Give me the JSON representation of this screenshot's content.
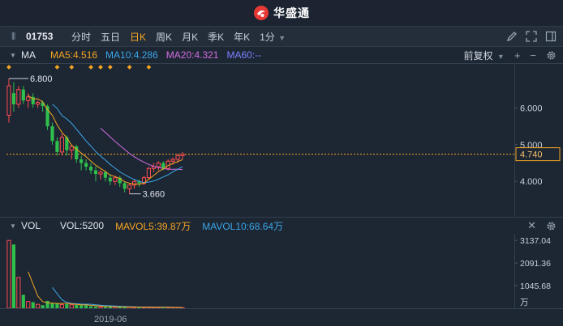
{
  "app": {
    "name": "华盛通"
  },
  "toolbar": {
    "handle_glyph": "⦀",
    "stock_code": "01753",
    "periods": [
      {
        "label": "分时",
        "active": false
      },
      {
        "label": "五日",
        "active": false
      },
      {
        "label": "日K",
        "active": true
      },
      {
        "label": "周K",
        "active": false
      },
      {
        "label": "月K",
        "active": false
      },
      {
        "label": "季K",
        "active": false
      },
      {
        "label": "年K",
        "active": false
      },
      {
        "label": "1分",
        "active": false,
        "dropdown": true
      }
    ],
    "icons": [
      "pencil-icon",
      "fullscreen-icon",
      "sidebar-toggle-icon"
    ]
  },
  "price_panel": {
    "label": "MA",
    "ma": [
      {
        "label": "MA5:4.516",
        "color": "#f5a623"
      },
      {
        "label": "MA10:4.286",
        "color": "#3aa7e8"
      },
      {
        "label": "MA20:4.321",
        "color": "#d36ee0"
      },
      {
        "label": "MA60:--",
        "color": "#7b82ff"
      }
    ],
    "adjust_label": "前复权",
    "high_label": "6.800",
    "low_label": "3.660",
    "current_price": "4.740",
    "axis_ticks": [
      "6.000",
      "5.000",
      "4.000"
    ],
    "axis_values": [
      6.0,
      5.0,
      4.0
    ],
    "current_value": 4.74
  },
  "volume_panel": {
    "label": "VOL",
    "vol_label": "VOL:5200",
    "mavol": [
      {
        "label": "MAVOL5:39.87万",
        "color": "#f5a623"
      },
      {
        "label": "MAVOL10:68.64万",
        "color": "#3aa7e8"
      }
    ],
    "axis_ticks": [
      "3137.04",
      "2091.36",
      "1045.68"
    ],
    "axis_unit": "万"
  },
  "date_axis": {
    "labels": [
      "2019-06"
    ]
  },
  "colors": {
    "up": "#ff4d4f",
    "down": "#2fbf4d",
    "ma5": "#f5a623",
    "ma10": "#3aa7e8",
    "ma20": "#d36ee0",
    "marker": "#f5a623"
  },
  "chart_data": {
    "type": "candlestick",
    "ylim": [
      3.3,
      7.0
    ],
    "candles": [
      {
        "o": 5.8,
        "c": 6.6,
        "h": 6.8,
        "l": 5.6
      },
      {
        "o": 6.4,
        "c": 6.1,
        "h": 6.7,
        "l": 5.9
      },
      {
        "o": 6.1,
        "c": 6.5,
        "h": 6.6,
        "l": 6.0
      },
      {
        "o": 6.5,
        "c": 6.2,
        "h": 6.6,
        "l": 6.1
      },
      {
        "o": 6.2,
        "c": 6.3,
        "h": 6.4,
        "l": 6.0
      },
      {
        "o": 6.3,
        "c": 6.1,
        "h": 6.4,
        "l": 6.0
      },
      {
        "o": 6.1,
        "c": 6.15,
        "h": 6.2,
        "l": 6.0
      },
      {
        "o": 6.15,
        "c": 6.05,
        "h": 6.2,
        "l": 5.9
      },
      {
        "o": 6.05,
        "c": 5.5,
        "h": 6.1,
        "l": 5.4
      },
      {
        "o": 5.5,
        "c": 5.1,
        "h": 5.6,
        "l": 5.0
      },
      {
        "o": 5.1,
        "c": 4.8,
        "h": 5.2,
        "l": 4.7
      },
      {
        "o": 4.8,
        "c": 5.2,
        "h": 5.3,
        "l": 4.7
      },
      {
        "o": 5.2,
        "c": 4.85,
        "h": 5.25,
        "l": 4.7
      },
      {
        "o": 4.85,
        "c": 4.95,
        "h": 5.0,
        "l": 4.6
      },
      {
        "o": 4.95,
        "c": 4.6,
        "h": 5.0,
        "l": 4.5
      },
      {
        "o": 4.6,
        "c": 4.5,
        "h": 4.7,
        "l": 4.3
      },
      {
        "o": 4.5,
        "c": 4.4,
        "h": 4.6,
        "l": 4.3
      },
      {
        "o": 4.4,
        "c": 4.3,
        "h": 4.5,
        "l": 4.2
      },
      {
        "o": 4.3,
        "c": 4.2,
        "h": 4.4,
        "l": 4.0
      },
      {
        "o": 4.2,
        "c": 4.25,
        "h": 4.3,
        "l": 4.05
      },
      {
        "o": 4.25,
        "c": 4.1,
        "h": 4.3,
        "l": 4.0
      },
      {
        "o": 4.1,
        "c": 4.0,
        "h": 4.2,
        "l": 3.9
      },
      {
        "o": 4.0,
        "c": 4.1,
        "h": 4.15,
        "l": 3.9
      },
      {
        "o": 4.1,
        "c": 3.95,
        "h": 4.15,
        "l": 3.85
      },
      {
        "o": 3.95,
        "c": 3.8,
        "h": 4.0,
        "l": 3.7
      },
      {
        "o": 3.8,
        "c": 3.9,
        "h": 3.95,
        "l": 3.66
      },
      {
        "o": 3.9,
        "c": 4.0,
        "h": 4.05,
        "l": 3.8
      },
      {
        "o": 4.0,
        "c": 3.95,
        "h": 4.05,
        "l": 3.85
      },
      {
        "o": 3.95,
        "c": 4.1,
        "h": 4.15,
        "l": 3.9
      },
      {
        "o": 4.1,
        "c": 4.35,
        "h": 4.4,
        "l": 4.05
      },
      {
        "o": 4.35,
        "c": 4.4,
        "h": 4.5,
        "l": 4.25
      },
      {
        "o": 4.4,
        "c": 4.5,
        "h": 4.55,
        "l": 4.3
      },
      {
        "o": 4.5,
        "c": 4.35,
        "h": 4.55,
        "l": 4.3
      },
      {
        "o": 4.35,
        "c": 4.55,
        "h": 4.6,
        "l": 4.3
      },
      {
        "o": 4.55,
        "c": 4.6,
        "h": 4.65,
        "l": 4.45
      },
      {
        "o": 4.6,
        "c": 4.7,
        "h": 4.75,
        "l": 4.5
      },
      {
        "o": 4.7,
        "c": 4.74,
        "h": 4.8,
        "l": 4.6
      }
    ],
    "volumes": [
      3137,
      2950,
      1420,
      620,
      310,
      280,
      180,
      140,
      340,
      240,
      210,
      170,
      190,
      160,
      150,
      140,
      130,
      90,
      80,
      70,
      60,
      65,
      55,
      50,
      60,
      55,
      45,
      40,
      35,
      50,
      45,
      40,
      30,
      35,
      30,
      25,
      25
    ],
    "ma5": [
      null,
      null,
      null,
      null,
      6.34,
      6.24,
      6.25,
      6.16,
      5.96,
      5.8,
      5.54,
      5.33,
      5.19,
      4.98,
      4.88,
      4.77,
      4.67,
      4.55,
      4.44,
      4.35,
      4.27,
      4.17,
      4.13,
      4.08,
      3.99,
      3.95,
      3.93,
      3.92,
      3.95,
      4.06,
      4.16,
      4.27,
      4.34,
      4.43,
      4.49,
      4.54,
      4.59
    ],
    "ma10": [
      null,
      null,
      null,
      null,
      null,
      null,
      null,
      null,
      null,
      6.1,
      5.99,
      5.79,
      5.7,
      5.58,
      5.42,
      5.26,
      5.1,
      4.96,
      4.81,
      4.69,
      4.58,
      4.46,
      4.36,
      4.26,
      4.18,
      4.11,
      4.05,
      4.0,
      3.97,
      3.98,
      4.01,
      4.06,
      4.12,
      4.18,
      4.26,
      4.33,
      4.4
    ],
    "ma20": [
      null,
      null,
      null,
      null,
      null,
      null,
      null,
      null,
      null,
      null,
      null,
      null,
      null,
      null,
      null,
      null,
      null,
      null,
      null,
      5.45,
      5.33,
      5.21,
      5.09,
      4.98,
      4.87,
      4.76,
      4.67,
      4.59,
      4.52,
      4.46,
      4.41,
      4.38,
      4.35,
      4.33,
      4.33,
      4.33,
      4.32
    ],
    "marker_indices": [
      0,
      10,
      13,
      17,
      19,
      21,
      25,
      29
    ]
  }
}
